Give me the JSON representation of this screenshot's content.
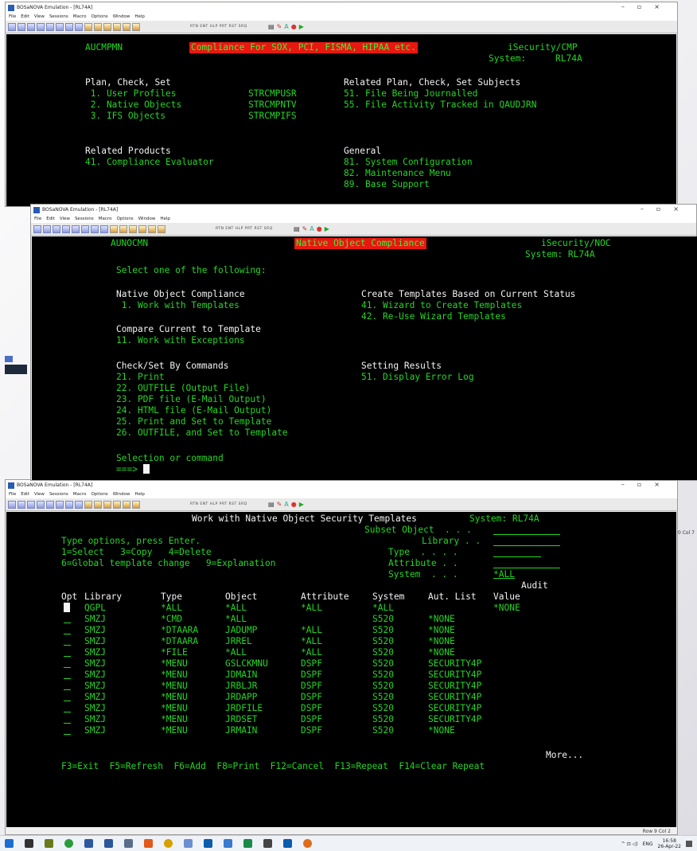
{
  "win1": {
    "title": "BOSaNOVA Emulation - [RL74A]",
    "menus": [
      "File",
      "Edit",
      "View",
      "Sessions",
      "Macro",
      "Options",
      "Window",
      "Help"
    ],
    "toolbar_text": "RTN ENT HLP PRT RST SRQ",
    "screen": {
      "menu_name": "AUCMPMN",
      "banner": "Compliance For SOX, PCI, FISMA, HIPAA etc.",
      "product": "iSecurity/CMP",
      "system_label": "System:",
      "system_value": "RL74A",
      "section1": "Plan, Check, Set",
      "opt1": " 1. User Profiles",
      "cmd1": "STRCMPUSR",
      "opt2": " 2. Native Objects",
      "cmd2": "STRCMPNTV",
      "opt3": " 3. IFS Objects",
      "cmd3": "STRCMPIFS",
      "section2": "Related Plan, Check, Set Subjects",
      "opt51": "51. File Being Journalled",
      "opt55": "55. File Activity Tracked in QAUDJRN",
      "section3": "Related Products",
      "opt41": "41. Compliance Evaluator",
      "section4": "General",
      "opt81": "81. System Configuration",
      "opt82": "82. Maintenance Menu",
      "opt89": "89. Base Support"
    }
  },
  "win2": {
    "title": "BOSaNOVA Emulation - [RL74A]",
    "menus": [
      "File",
      "Edit",
      "View",
      "Sessions",
      "Macro",
      "Options",
      "Window",
      "Help"
    ],
    "toolbar_text": "RTN ENT HLP PRT RST SRQ",
    "screen": {
      "menu_name": "AUNOCMN",
      "banner": "Native Object Compliance",
      "product": "iSecurity/NOC",
      "system": "System: RL74A",
      "prompt": "Select one of the following:",
      "sec1": "Native Object Compliance",
      "o1": " 1. Work with Templates",
      "sec2": "Create Templates Based on Current Status",
      "o41": "41. Wizard to Create Templates",
      "o42": "42. Re-Use Wizard Templates",
      "sec3": "Compare Current to Template",
      "o11": "11. Work with Exceptions",
      "sec4": "Check/Set By Commands",
      "o21": "21. Print",
      "o22": "22. OUTFILE (Output File)",
      "o23": "23. PDF file (E-Mail Output)",
      "o24": "24. HTML file (E-Mail Output)",
      "o25": "25. Print and Set to Template",
      "o26": "26. OUTFILE, and Set to Template",
      "sec5": "Setting Results",
      "o51": "51. Display Error Log",
      "sel": "Selection or command",
      "arrow": "===>"
    }
  },
  "win3": {
    "title": "BOSaNOVA Emulation - [RL74A]",
    "menus": [
      "File",
      "Edit",
      "View",
      "Sessions",
      "Macro",
      "Options",
      "Window",
      "Help"
    ],
    "toolbar_text": "RTN ENT HLP PRT RST SRQ",
    "status": "Row 9 Col 2",
    "screen": {
      "title": "Work with Native Object Security Templates",
      "system": "System: RL74A",
      "subset": "Subset Object  . . .",
      "library": "Library . .",
      "type": "Type  . . . .",
      "attribute": "Attribute . .",
      "system_f": "System  . . .",
      "system_val": "*ALL",
      "type_options": "Type options, press Enter.",
      "opts1": "1=Select   3=Copy   4=Delete",
      "opts2": "6=Global template change   9=Explanation",
      "audit": "Audit",
      "columns": [
        "Opt",
        "Library",
        "Type",
        "Object",
        "Attribute",
        "System",
        "Aut. List",
        "Value"
      ],
      "rows": [
        [
          "QGPL",
          "*ALL",
          "*ALL",
          "*ALL",
          "*ALL",
          "",
          "*NONE"
        ],
        [
          "SMZJ",
          "*CMD",
          "*ALL",
          "",
          "S520",
          "*NONE",
          ""
        ],
        [
          "SMZJ",
          "*DTAARA",
          "JADUMP",
          "*ALL",
          "S520",
          "*NONE",
          ""
        ],
        [
          "SMZJ",
          "*DTAARA",
          "JRREL",
          "*ALL",
          "S520",
          "*NONE",
          ""
        ],
        [
          "SMZJ",
          "*FILE",
          "*ALL",
          "*ALL",
          "S520",
          "*NONE",
          ""
        ],
        [
          "SMZJ",
          "*MENU",
          "GSLCKMNU",
          "DSPF",
          "S520",
          "SECURITY4P",
          ""
        ],
        [
          "SMZJ",
          "*MENU",
          "JDMAIN",
          "DSPF",
          "S520",
          "SECURITY4P",
          ""
        ],
        [
          "SMZJ",
          "*MENU",
          "JRBLJR",
          "DSPF",
          "S520",
          "SECURITY4P",
          ""
        ],
        [
          "SMZJ",
          "*MENU",
          "JRDAPP",
          "DSPF",
          "S520",
          "SECURITY4P",
          ""
        ],
        [
          "SMZJ",
          "*MENU",
          "JRDFILE",
          "DSPF",
          "S520",
          "SECURITY4P",
          ""
        ],
        [
          "SMZJ",
          "*MENU",
          "JRDSET",
          "DSPF",
          "S520",
          "SECURITY4P",
          ""
        ],
        [
          "SMZJ",
          "*MENU",
          "JRMAIN",
          "DSPF",
          "S520",
          "*NONE",
          ""
        ]
      ],
      "more": "More...",
      "fkeys": "F3=Exit  F5=Refresh  F6=Add  F8=Print  F12=Cancel  F13=Repeat  F14=Clear Repeat"
    }
  },
  "side": {
    "col": "0 Col 7"
  },
  "tray": {
    "lang": "ENG",
    "time": "16:58",
    "date": "26-Apr-22"
  },
  "taskbar_icons": [
    "windows-start-icon",
    "task-view-icon",
    "app-icon-1",
    "chrome-icon",
    "app-icon-2",
    "word-icon",
    "app-icon-3",
    "app-icon-4",
    "outlook-icon",
    "app-icon-5",
    "app-icon-6",
    "app-icon-7",
    "app-icon-8",
    "app-icon-9",
    "app-icon-10",
    "app-icon-11"
  ]
}
